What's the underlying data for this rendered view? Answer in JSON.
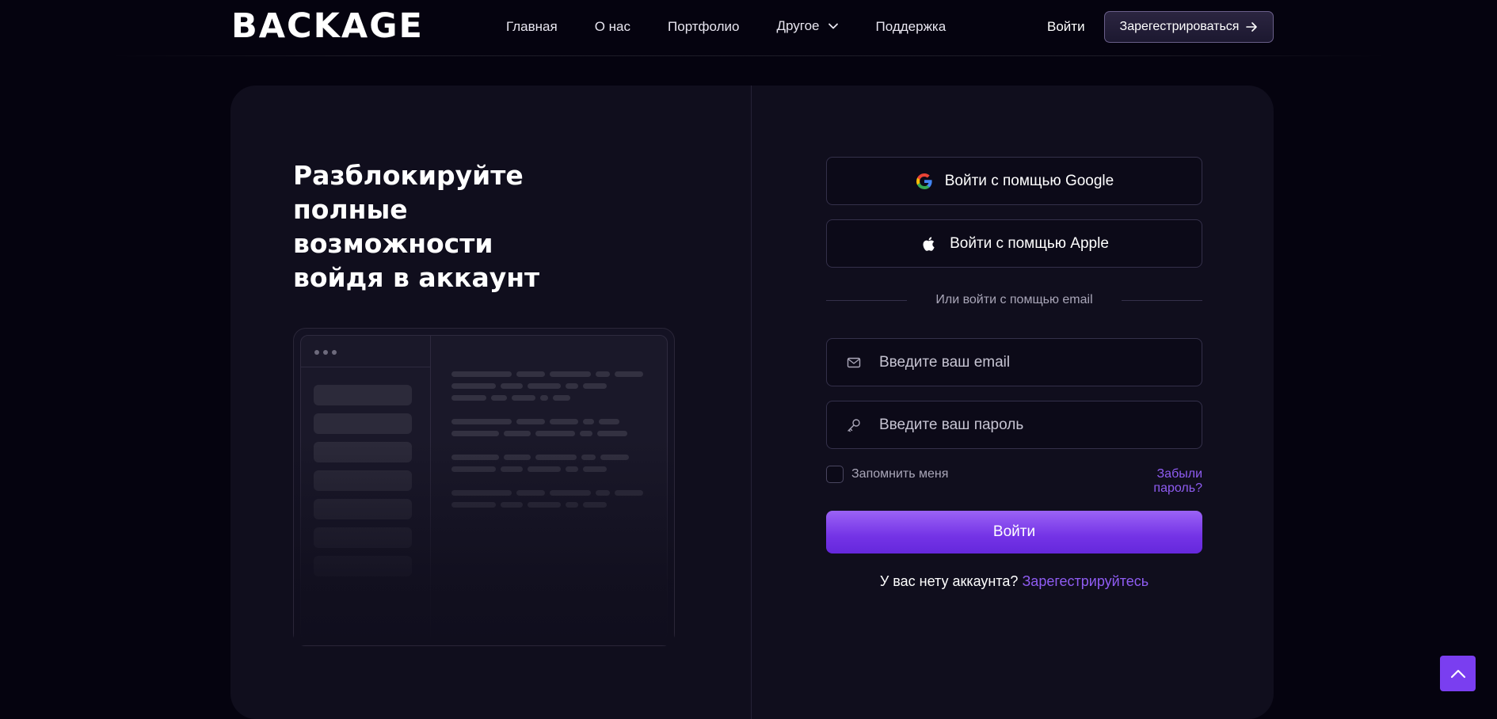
{
  "header": {
    "logo": "BACKAGE",
    "nav": [
      {
        "label": "Главная"
      },
      {
        "label": "О нас"
      },
      {
        "label": "Портфолио"
      },
      {
        "label": "Другое"
      },
      {
        "label": "Поддержка"
      }
    ],
    "login_label": "Войти",
    "register_label": "Зарегестрироваться"
  },
  "hero": {
    "headline": "Разблокируйте полные возможности войдя в аккаунт"
  },
  "form": {
    "google_label": "Войти с помщью Google",
    "apple_label": "Войти с помщью Apple",
    "divider_text": "Или войти с помщью email",
    "email_placeholder": "Введите ваш email",
    "password_placeholder": "Введите ваш пароль",
    "remember_label": "Запомнить меня",
    "forgot_label": "Забыли пароль?",
    "submit_label": "Войти",
    "no_account_text": "У вас нету аккаунта?",
    "signup_link": "Зарегестрируйтесь"
  },
  "colors": {
    "background": "#05030f",
    "card": "#100e1d",
    "accent": "#7433e6",
    "link": "#8f5cf2"
  },
  "icons": {
    "google": "google-icon",
    "apple": "apple-icon",
    "email": "mail-icon",
    "password": "key-icon",
    "scroll_top": "chevron-up-icon",
    "register_arrow": "arrow-right-icon",
    "dropdown": "chevron-down-icon"
  }
}
